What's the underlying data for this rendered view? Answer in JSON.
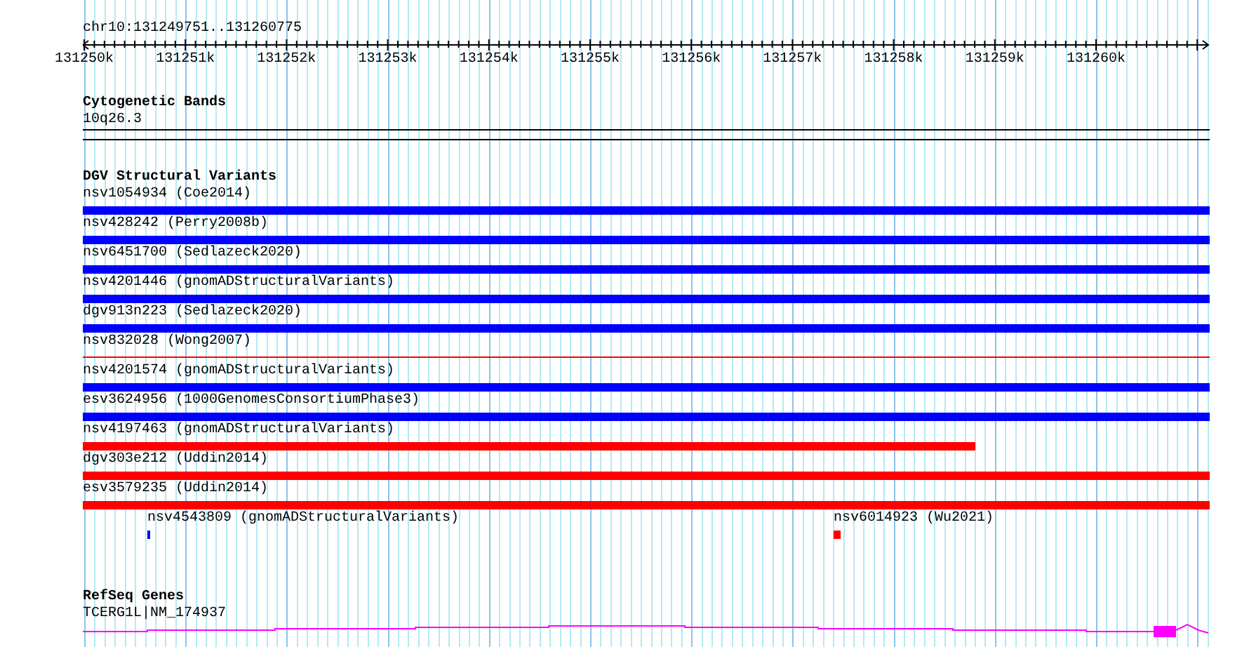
{
  "ruler": {
    "position": "chr10:131249751..131260775",
    "tick_labels": [
      "131250k",
      "131251k",
      "131252k",
      "131253k",
      "131254k",
      "131255k",
      "131256k",
      "131257k",
      "131258k",
      "131259k",
      "131260k"
    ]
  },
  "cytogenetic_bands": {
    "title": "Cytogenetic Bands",
    "band": "10q26.3"
  },
  "dgv": {
    "title": "DGV Structural Variants",
    "rows": [
      {
        "kind": "full",
        "label": "nsv1054934 (Coe2014)",
        "color": "#0000ff"
      },
      {
        "kind": "full",
        "label": "nsv428242 (Perry2008b)",
        "color": "#0000ff"
      },
      {
        "kind": "full",
        "label": "nsv6451700 (Sedlazeck2020)",
        "color": "#0000ff"
      },
      {
        "kind": "full",
        "label": "nsv4201446 (gnomADStructuralVariants)",
        "color": "#0000ff"
      },
      {
        "kind": "full",
        "label": "dgv913n223 (Sedlazeck2020)",
        "color": "#0000ff"
      },
      {
        "kind": "thin",
        "label": "nsv832028 (Wong2007)",
        "color": "#ff0000"
      },
      {
        "kind": "full",
        "label": "nsv4201574 (gnomADStructuralVariants)",
        "color": "#0000ff"
      },
      {
        "kind": "full",
        "label": "esv3624956 (1000GenomesConsortiumPhase3)",
        "color": "#0000ff"
      },
      {
        "kind": "partial",
        "label": "nsv4197463 (gnomADStructuralVariants)",
        "color": "#ff0000"
      },
      {
        "kind": "full",
        "label": "dgv303e212 (Uddin2014)",
        "color": "#ff0000"
      },
      {
        "kind": "full",
        "label": "esv3579235 (Uddin2014)",
        "color": "#ff0000"
      },
      {
        "kind": "points",
        "features": [
          {
            "label": "nsv4543809 (gnomADStructuralVariants)",
            "color": "#0000ff",
            "kind": "tick"
          },
          {
            "label": "nsv6014923 (Wu2021)",
            "color": "#ff0000",
            "kind": "square"
          }
        ]
      }
    ]
  },
  "refseq_genes": {
    "title": "RefSeq Genes",
    "gene": "TCERG1L|NM_174937"
  }
}
